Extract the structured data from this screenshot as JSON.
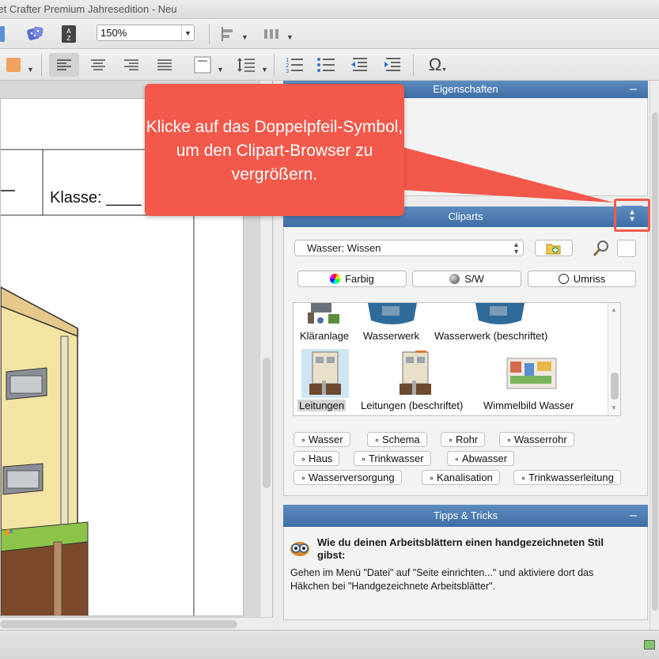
{
  "window": {
    "title": "ksheet Crafter Premium Jahresedition - Neu"
  },
  "toolbar": {
    "zoom_value": "150%"
  },
  "toolbar2": {
    "special_char": "Ω"
  },
  "document": {
    "klasse_text": "Klasse: ____"
  },
  "properties_panel": {
    "title": "Eigenschaften",
    "collapse": "–"
  },
  "cliparts_panel": {
    "title": "Cliparts",
    "category_value": "Wasser: Wissen",
    "filters": {
      "colored": "Farbig",
      "bw": "S/W",
      "outline": "Umriss"
    },
    "items": [
      {
        "label": "Kläranlage",
        "selected": false
      },
      {
        "label": "Wasserwerk",
        "selected": false
      },
      {
        "label": "Wasserwerk (beschriftet)",
        "selected": false
      },
      {
        "label": "Leitungen",
        "selected": true
      },
      {
        "label": "Leitungen (beschriftet)",
        "selected": false
      },
      {
        "label": "Wimmelbild Wasser",
        "selected": false
      }
    ],
    "tags": [
      "Wasser",
      "Schema",
      "Rohr",
      "Wasserrohr",
      "Haus",
      "Trinkwasser",
      "Abwasser",
      "Wasserversorgung",
      "Kanalisation",
      "Trinkwasserleitung"
    ]
  },
  "tips_panel": {
    "title": "Tipps & Tricks",
    "collapse": "–",
    "heading": "Wie du deinen Arbeitsblättern einen handgezeichneten Stil gibst:",
    "body": "Gehen im Menü \"Datei\" auf \"Seite einrichten...\" und aktiviere dort das Häkchen bei \"Handgezeichnete Arbeitsblätter\"."
  },
  "callout": {
    "text": "Klicke auf das Doppelpfeil-Symbol, um den Clipart-Browser zu vergrößern.",
    "color": "#f2594b"
  },
  "colors": {
    "header_blue": "#4a7bb3",
    "callout_red": "#f2594b"
  }
}
